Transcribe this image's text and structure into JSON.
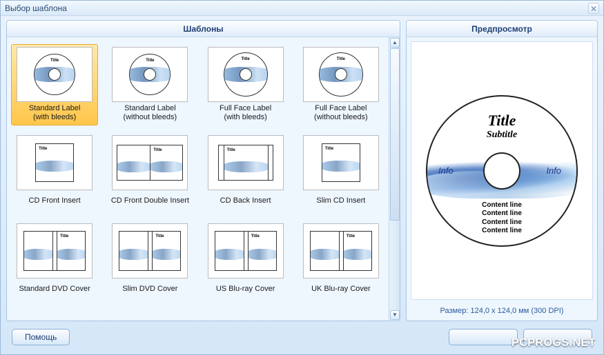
{
  "window": {
    "title": "Выбор шаблона"
  },
  "panels": {
    "templates_header": "Шаблоны",
    "preview_header": "Предпросмотр"
  },
  "templates": [
    {
      "label": "Standard Label\n(with bleeds)",
      "kind": "disc",
      "selected": true
    },
    {
      "label": "Standard Label\n(without bleeds)",
      "kind": "disc"
    },
    {
      "label": "Full Face Label\n(with bleeds)",
      "kind": "disc-full"
    },
    {
      "label": "Full Face Label\n(without bleeds)",
      "kind": "disc-full"
    },
    {
      "label": "CD Front Insert",
      "kind": "square"
    },
    {
      "label": "CD Front Double Insert",
      "kind": "square-double"
    },
    {
      "label": "CD Back Insert",
      "kind": "back-insert"
    },
    {
      "label": "Slim CD Insert",
      "kind": "square"
    },
    {
      "label": "Standard DVD Cover",
      "kind": "dvd"
    },
    {
      "label": "Slim DVD Cover",
      "kind": "dvd"
    },
    {
      "label": "US Blu-ray Cover",
      "kind": "dvd"
    },
    {
      "label": "UK Blu-ray Cover",
      "kind": "dvd"
    }
  ],
  "preview": {
    "title": "Title",
    "subtitle": "Subtitle",
    "info_left": "Info",
    "info_right": "Info",
    "content_lines": [
      "Content line",
      "Content line",
      "Content line",
      "Content line"
    ],
    "size_text": "Размер:  124,0 x 124,0 мм (300 DPI)"
  },
  "buttons": {
    "help": "Помощь"
  },
  "watermark": "PCPROGS.NET"
}
